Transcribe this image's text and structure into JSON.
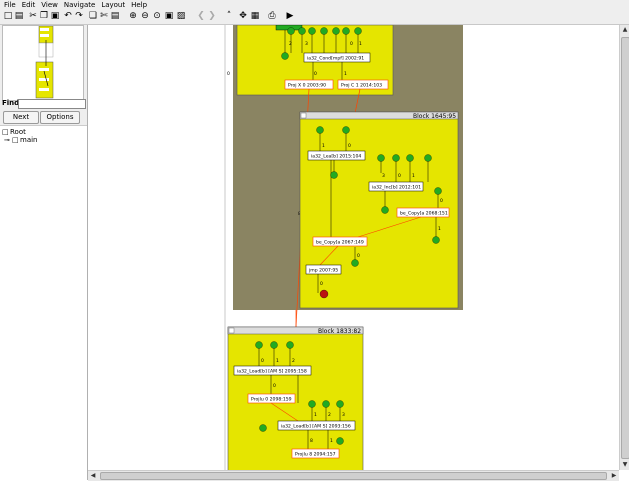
{
  "menu": [
    "File",
    "Edit",
    "View",
    "Navigate",
    "Layout",
    "Help"
  ],
  "toolbar_icons": [
    "new-icon",
    "open-icon",
    "undo-icon",
    "redo-icon",
    "cut-icon",
    "copy-icon",
    "paste-icon",
    "zoom-in-icon",
    "zoom-out-icon",
    "zoom-fit-icon",
    "zoom-box-icon",
    "back-icon",
    "forward-icon",
    "up-icon",
    "move-icon",
    "layout-icon",
    "print-icon",
    "run-icon"
  ],
  "left": {
    "find_label": "Find:",
    "find_value": "",
    "next_label": "Next",
    "options_label": "Options",
    "tree": {
      "root": "Root",
      "child": "main"
    }
  },
  "graph": {
    "edge_zero_label": "0",
    "edge_eight_label": "8",
    "block_top": {
      "nodes": {
        "cond": "ia32_Cond[mpf] 2002:91",
        "proj0": "Proj X 0 2003:90",
        "proj1": "Proj C 1 2014:103"
      },
      "labels": {
        "e0": "0",
        "e1": "1",
        "e2": "2",
        "e3": "3",
        "e4": "0",
        "e5": "1"
      }
    },
    "block_mid": {
      "title": "Block 1645:95",
      "nodes": {
        "load": "ia32_Lea[b] 2015:104",
        "inc": "ia32_Inc[b] 2012:101",
        "copy_r": "be_Copy[a 2068:151",
        "copy_l": "be_Copy[a 2067:149",
        "jmp": "jmp 2007:95"
      },
      "labels": {
        "e0": "0",
        "e1": "1",
        "e2": "0",
        "e3": "3",
        "e4": "0",
        "e5": "1",
        "e6": "0",
        "e7": "1",
        "e8": "0"
      }
    },
    "block_bot": {
      "title": "Block 1833:82",
      "nodes": {
        "load1": "ia32_Load[b] [AM S] 2095:158",
        "proj0": "Projlu 0 2098:159",
        "load2": "ia32_Load[b] [AM S] 2093:156",
        "proj2": "Projlu 8 2094:157"
      },
      "labels": {
        "e0": "0",
        "e1": "1",
        "e2": "2",
        "e3": "0",
        "e4": "1",
        "e5": "2",
        "e6": "3",
        "e7": "8",
        "e8": "1"
      }
    }
  },
  "colors": {
    "block_fill": "#e5e500",
    "block_outer": "#8a8462",
    "node_green": "#22aa22",
    "node_red": "#bb1111",
    "edge_red": "#ff4400"
  }
}
